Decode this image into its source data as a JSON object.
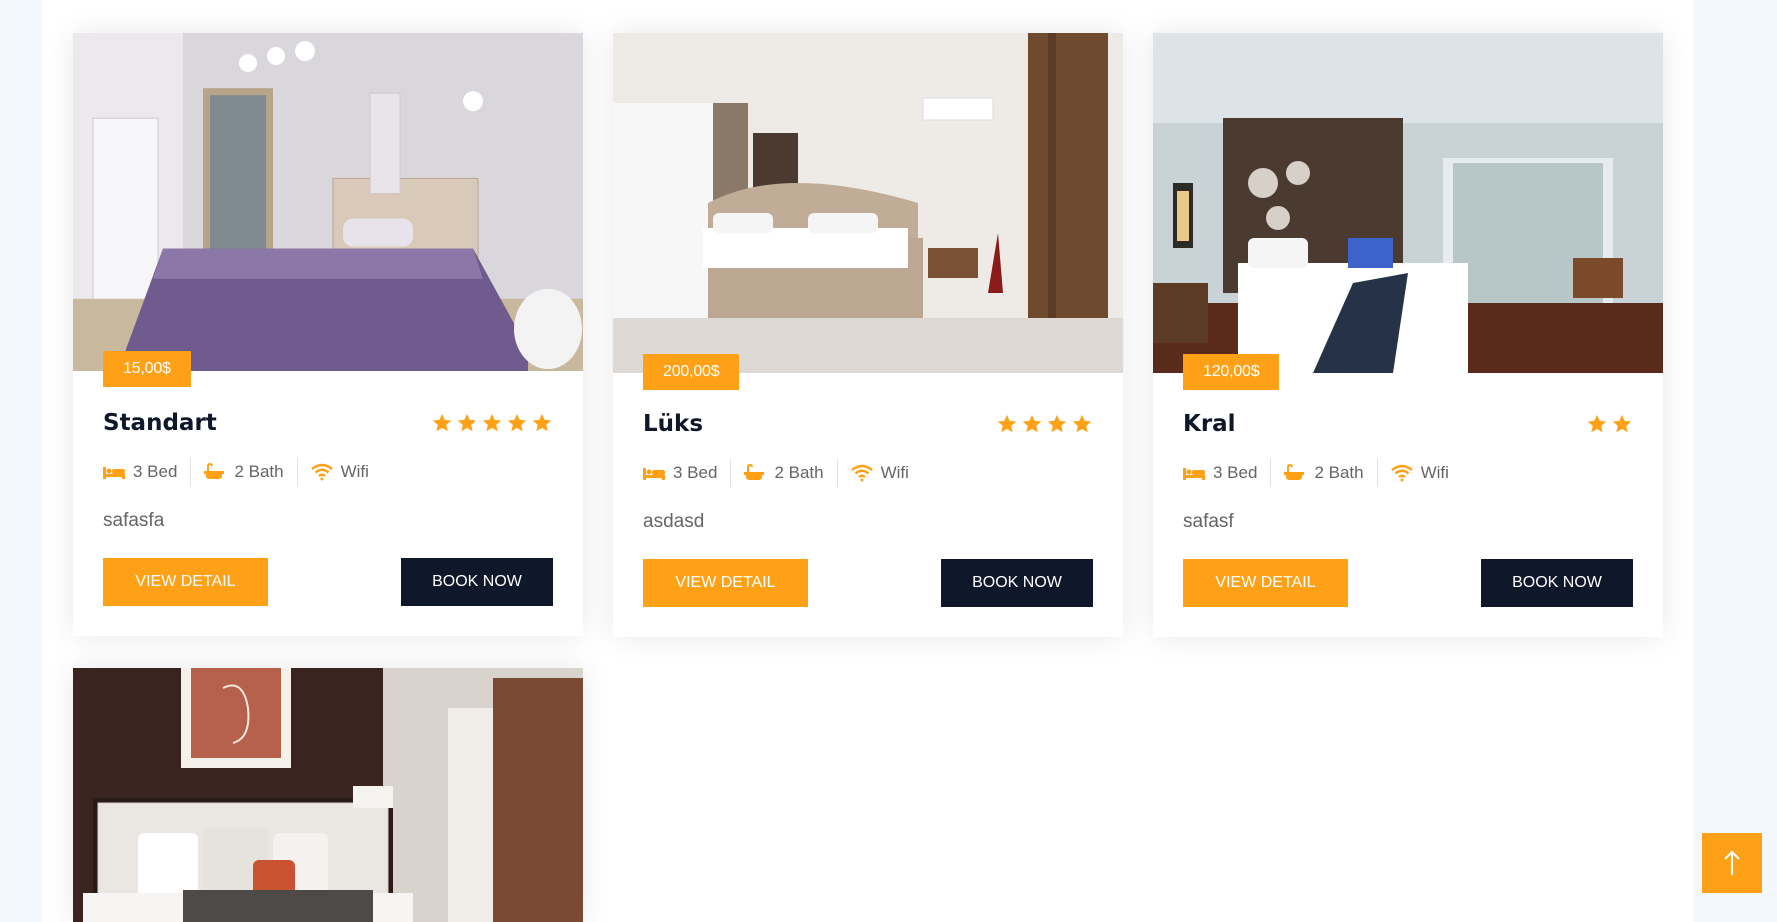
{
  "colors": {
    "accent": "#fea116",
    "dark": "#0f172b",
    "text": "#666565"
  },
  "rooms": [
    {
      "name": "Standart",
      "price": "15,00$",
      "rating": 5,
      "features": [
        {
          "icon": "bed-icon",
          "label": "3 Bed"
        },
        {
          "icon": "bath-icon",
          "label": "2 Bath"
        },
        {
          "icon": "wifi-icon",
          "label": "Wifi"
        }
      ],
      "description": "safasfa",
      "view_label": "View Detail",
      "book_label": "Book Now"
    },
    {
      "name": "Lüks",
      "price": "200,00$",
      "rating": 4,
      "features": [
        {
          "icon": "bed-icon",
          "label": "3 Bed"
        },
        {
          "icon": "bath-icon",
          "label": "2 Bath"
        },
        {
          "icon": "wifi-icon",
          "label": "Wifi"
        }
      ],
      "description": "asdasd",
      "view_label": "View Detail",
      "book_label": "Book Now"
    },
    {
      "name": "Kral",
      "price": "120,00$",
      "rating": 2,
      "features": [
        {
          "icon": "bed-icon",
          "label": "3 Bed"
        },
        {
          "icon": "bath-icon",
          "label": "2 Bath"
        },
        {
          "icon": "wifi-icon",
          "label": "Wifi"
        }
      ],
      "description": "safasf",
      "view_label": "View Detail",
      "book_label": "Book Now"
    },
    {
      "name": "",
      "price": "",
      "rating": 0,
      "features": [],
      "description": "",
      "view_label": "",
      "book_label": ""
    }
  ],
  "back_to_top_icon": "arrow-up-icon"
}
